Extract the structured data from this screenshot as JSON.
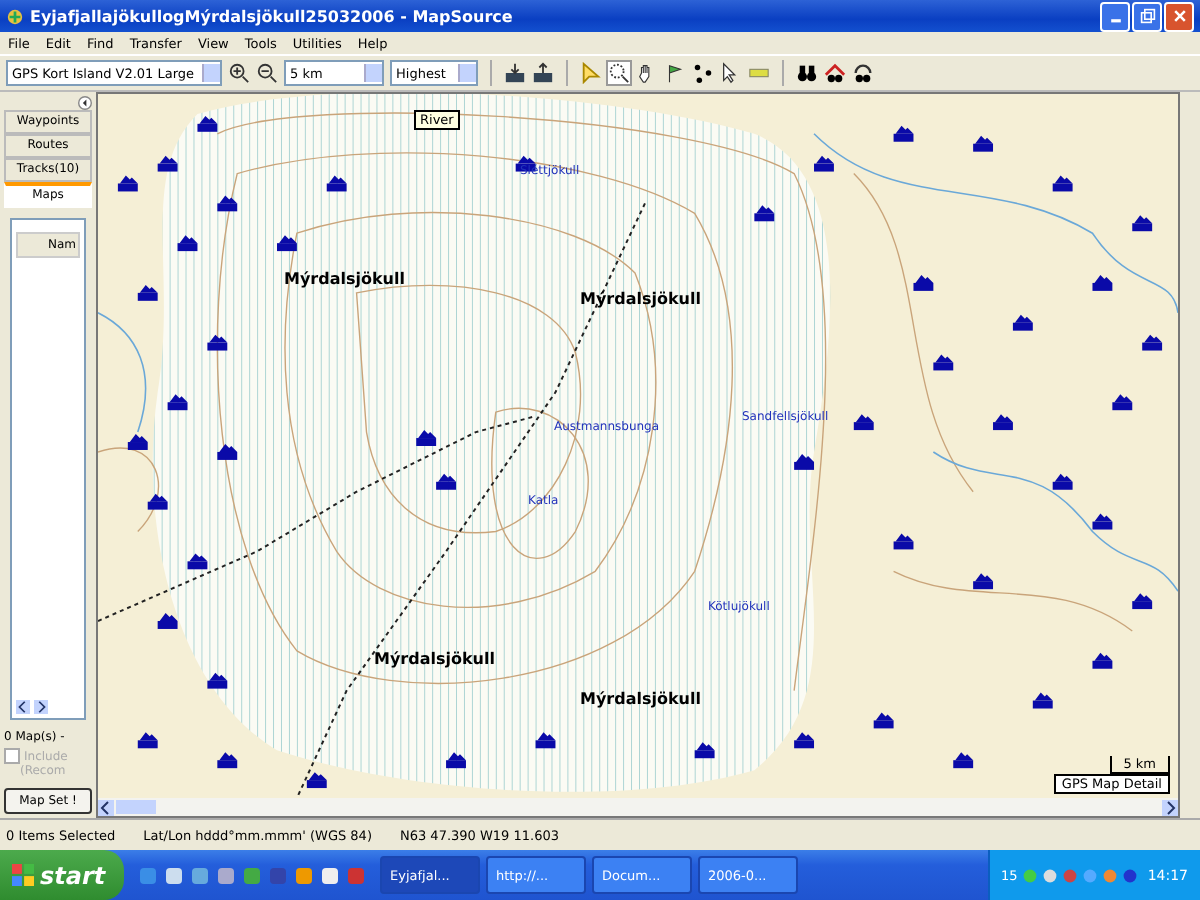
{
  "window": {
    "title": "EyjafjallajökullogMýrdalsjökull25032006 - MapSource"
  },
  "menu": [
    "File",
    "Edit",
    "Find",
    "Transfer",
    "View",
    "Tools",
    "Utilities",
    "Help"
  ],
  "toolbar": {
    "product": "GPS Kort Island V2.01 Large",
    "zoom": "5 km",
    "detail": "Highest"
  },
  "sidebar": {
    "tabs": [
      {
        "label": "Waypoints",
        "selected": false
      },
      {
        "label": "Routes",
        "selected": false
      },
      {
        "label": "Tracks(10)",
        "selected": false
      },
      {
        "label": "Maps",
        "selected": true
      }
    ],
    "column": "Nam",
    "count": "0 Map(s) -",
    "include": {
      "label": "Include",
      "note": "(Recom",
      "checked": false,
      "disabled": true
    },
    "button": "Map Set !"
  },
  "map": {
    "tooltip": "River",
    "labels": [
      {
        "text": "Sléttjökull",
        "kind": "place"
      },
      {
        "text": "Mýrdalsjökull",
        "kind": "glacier"
      },
      {
        "text": "Mýrdalsjökull",
        "kind": "glacier"
      },
      {
        "text": "Sandfellsjökull",
        "kind": "place"
      },
      {
        "text": "Austmannsbunga",
        "kind": "place"
      },
      {
        "text": "Katla",
        "kind": "place"
      },
      {
        "text": "Kötlujökull",
        "kind": "place"
      },
      {
        "text": "Mýrdalsjökull",
        "kind": "glacier"
      },
      {
        "text": "Mýrdalsjökull",
        "kind": "glacier"
      }
    ],
    "scale": "5 km",
    "detail_label": "GPS Map Detail"
  },
  "status_bar": [
    "0 Items Selected",
    "Lat/Lon hddd°mm.mmm' (WGS 84)",
    "N63 47.390 W19 11.603"
  ],
  "taskbar": {
    "start": "start",
    "tasks": [
      {
        "label": "Eyjafjal...",
        "selected": true
      },
      {
        "label": "http://...",
        "selected": false
      },
      {
        "label": "Docum...",
        "selected": false
      },
      {
        "label": "2006-0...",
        "selected": false
      }
    ],
    "tray_count": "15",
    "clock": "14:17"
  }
}
